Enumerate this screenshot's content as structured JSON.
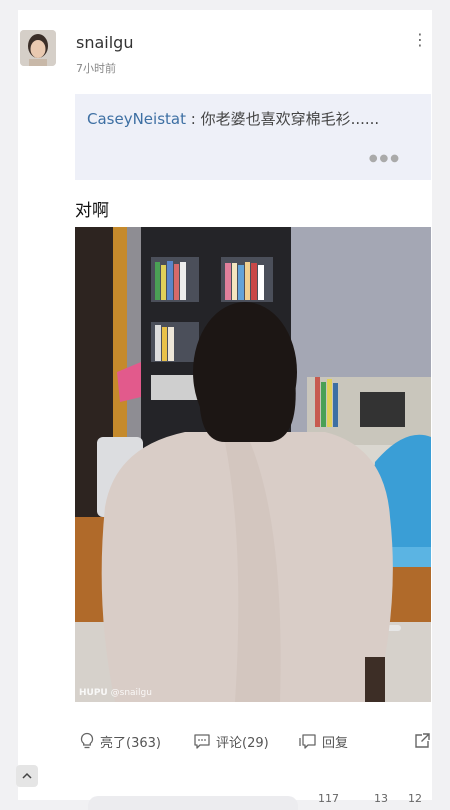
{
  "post": {
    "username": "snailgu",
    "time_ago": "7小时前",
    "quote_author": "CaseyNeistat",
    "quote_separator": " : ",
    "quote_text": "你老婆也喜欢穿棉毛衫......",
    "content": "对啊",
    "watermark_brand": "HUPU",
    "watermark_user": "@snailgu"
  },
  "actions": {
    "light_label": "亮了(363)",
    "comment_label": "评论(29)",
    "reply_label": "回复"
  },
  "bottom_bar": {
    "count_1": "117",
    "count_2": "13",
    "count_3": "12"
  },
  "colors": {
    "link_blue": "#3d6fa3",
    "quote_bg": "#eef0f8"
  }
}
